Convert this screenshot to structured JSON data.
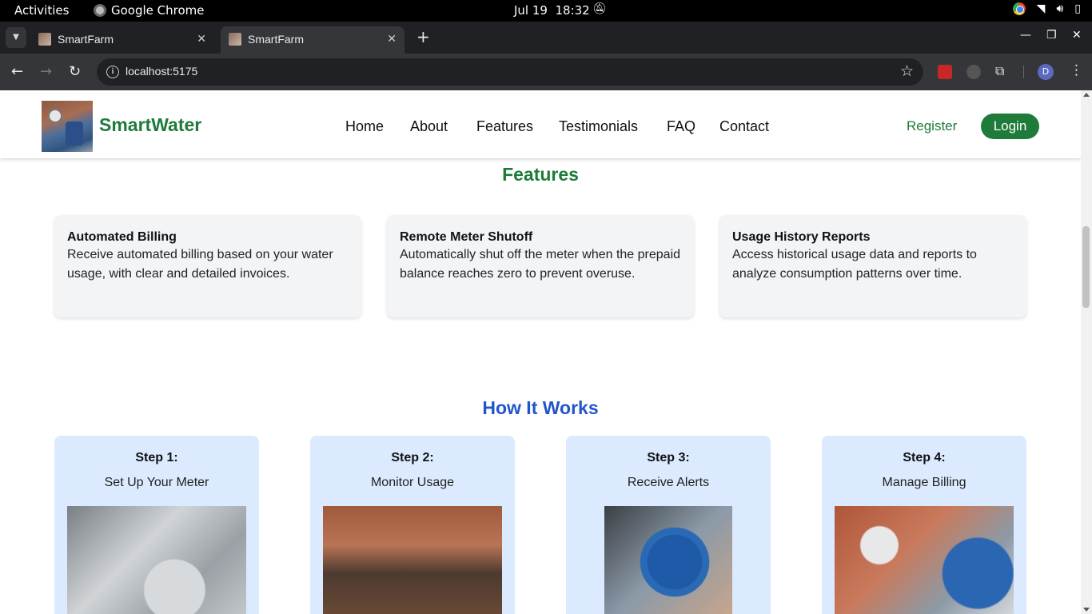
{
  "os": {
    "activities": "Activities",
    "app_name": "Google Chrome",
    "date": "Jul 19",
    "time": "18:32"
  },
  "browser": {
    "tabs": [
      {
        "title": "SmartFarm",
        "active": false
      },
      {
        "title": "SmartFarm",
        "active": true
      }
    ],
    "url": "localhost:5175",
    "profile_initial": "D"
  },
  "site": {
    "brand": "SmartWater",
    "nav": [
      "Home",
      "About",
      "Features",
      "Testimonials",
      "FAQ",
      "Contact"
    ],
    "register": "Register",
    "login": "Login",
    "colors": {
      "brand_green": "#1e7b3a",
      "how_blue": "#2255cc",
      "step_bg": "#dbeafe",
      "card_bg": "#f3f4f6"
    }
  },
  "features": {
    "title": "Features",
    "items": [
      {
        "title": "Automated Billing",
        "desc": "Receive automated billing based on your water usage, with clear and detailed invoices."
      },
      {
        "title": "Remote Meter Shutoff",
        "desc": "Automatically shut off the meter when the prepaid balance reaches zero to prevent overuse."
      },
      {
        "title": "Usage History Reports",
        "desc": "Access historical usage data and reports to analyze consumption patterns over time."
      }
    ]
  },
  "how": {
    "title": "How It Works",
    "steps": [
      {
        "number": "Step 1:",
        "title": "Set Up Your Meter",
        "image": "water-meter-photo"
      },
      {
        "number": "Step 2:",
        "title": "Monitor Usage",
        "image": "children-group-photo"
      },
      {
        "number": "Step 3:",
        "title": "Receive Alerts",
        "image": "digital-meter-photo"
      },
      {
        "number": "Step 4:",
        "title": "Manage Billing",
        "image": "pipes-gauges-photo"
      }
    ]
  }
}
